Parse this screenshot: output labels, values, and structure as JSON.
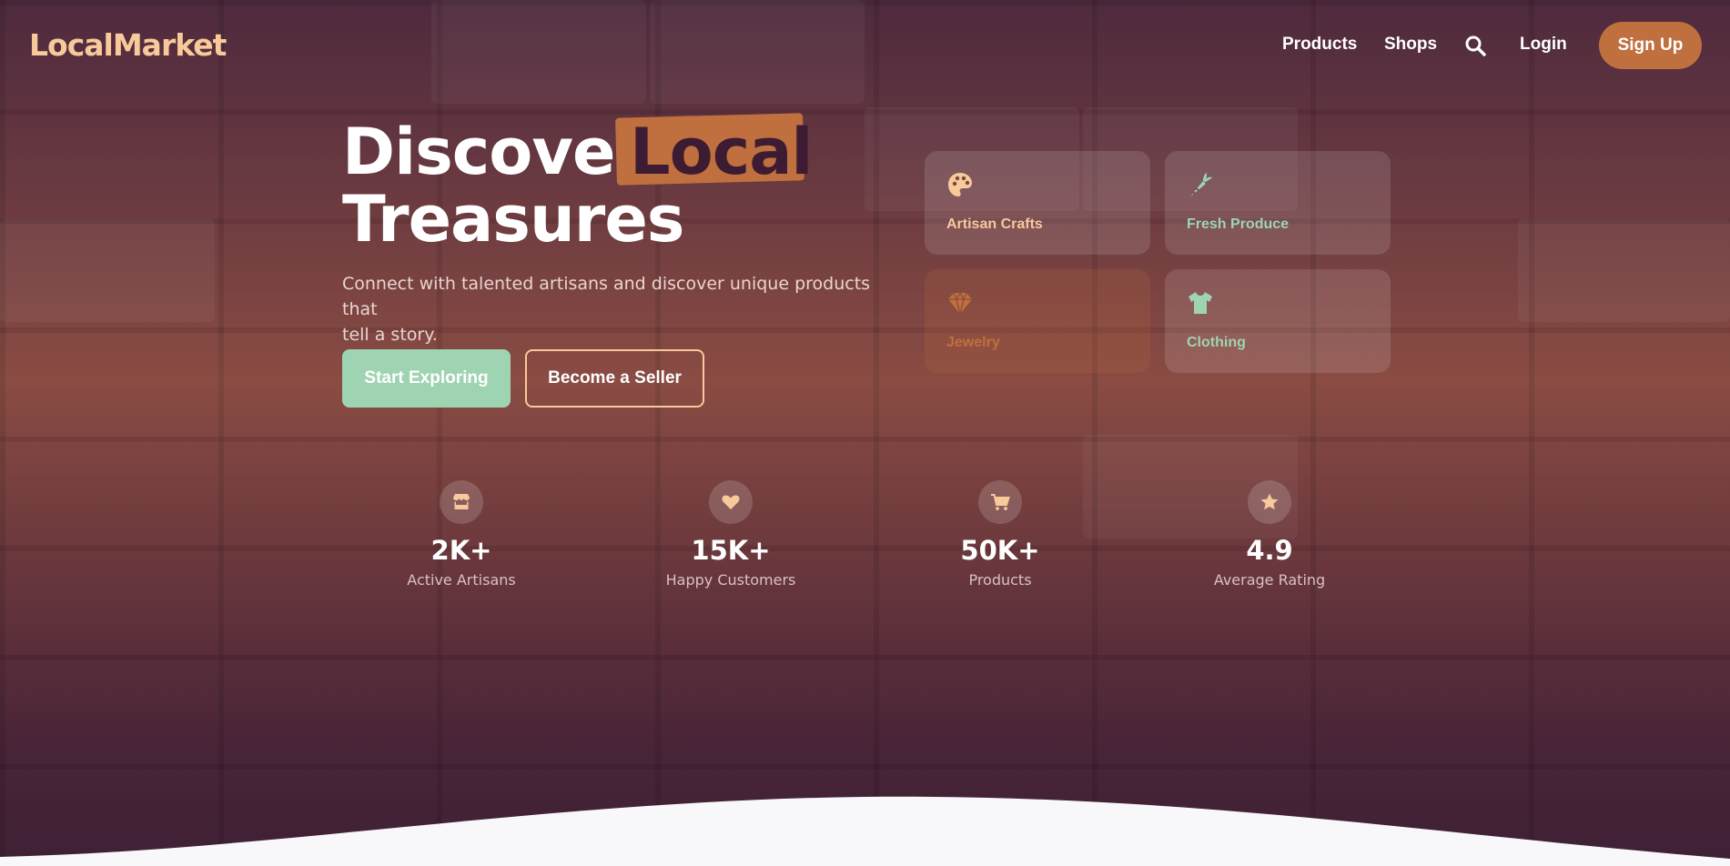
{
  "brand": {
    "name": "LocalMarket"
  },
  "nav": {
    "links": [
      "Products",
      "Shops",
      "Login"
    ],
    "signup_label": "Sign Up"
  },
  "hero": {
    "headline_part1": "Discover",
    "headline_highlight": "Local",
    "headline_part2": "Treasures",
    "subtitle_line1": "Connect with talented artisans and discover unique products that",
    "subtitle_line2": "tell a story.",
    "primary_cta": "Start Exploring",
    "secondary_cta": "Become a Seller"
  },
  "categories": [
    {
      "label": "Artisan Crafts",
      "icon": "palette-icon",
      "color": "#f8c99a"
    },
    {
      "label": "Fresh Produce",
      "icon": "carrot-icon",
      "color": "#9fd4b3"
    },
    {
      "label": "Jewelry",
      "icon": "gem-icon",
      "color": "#c0703f"
    },
    {
      "label": "Clothing",
      "icon": "shirt-icon",
      "color": "#9fd4b3"
    }
  ],
  "stats": [
    {
      "value": "2K+",
      "label": "Active Artisans",
      "icon": "store-icon"
    },
    {
      "value": "15K+",
      "label": "Happy Customers",
      "icon": "heart-icon"
    },
    {
      "value": "50K+",
      "label": "Products",
      "icon": "cart-icon"
    },
    {
      "value": "4.9",
      "label": "Average Rating",
      "icon": "star-icon"
    }
  ],
  "colors": {
    "accent": "#c0703f",
    "brand": "#f8c99a",
    "mint": "#9fd4b3",
    "dark_plum": "#3d1c33"
  }
}
